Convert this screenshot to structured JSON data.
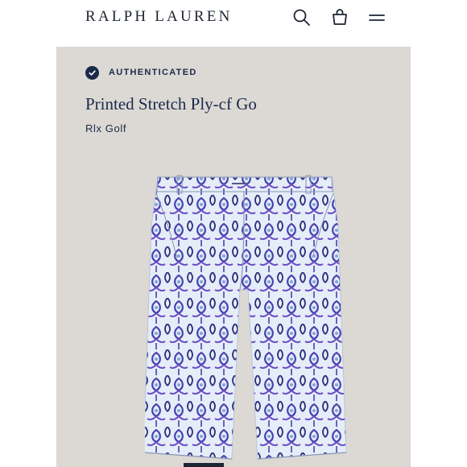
{
  "header": {
    "logo": "RALPH LAUREN",
    "icons": [
      "search-icon",
      "shopping-bag-icon",
      "menu-icon"
    ]
  },
  "product": {
    "badge": "AUTHENTICATED",
    "title": "Printed Stretch Ply-cf Go",
    "brand": "Rlx Golf",
    "image_icon": "printed-golf-shorts",
    "print_colors": [
      "#e4edf8",
      "#4a3fb0",
      "#6b4cc4",
      "#2b2b78"
    ]
  },
  "colors": {
    "navy": "#1b2a4a",
    "background": "#dcd9d4"
  }
}
